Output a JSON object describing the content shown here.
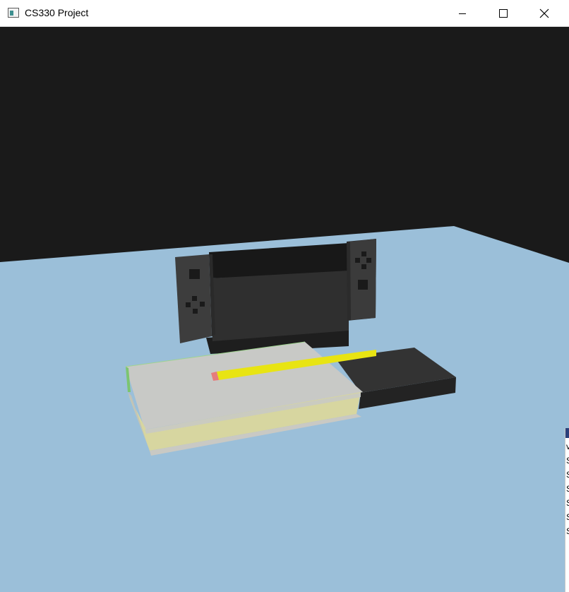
{
  "window": {
    "title": "CS330 Project"
  },
  "titlebar_icons": {
    "app": "app-window-icon",
    "minimize": "minimize-icon",
    "maximize": "maximize-icon",
    "close": "close-icon"
  },
  "scene": {
    "background_color": "#1a1a1a",
    "table_color": "#9bbfd9",
    "objects": [
      "game-console-with-controllers",
      "dock",
      "book",
      "pencil",
      "black-case"
    ]
  },
  "side_strip": {
    "chars": [
      "v",
      "S",
      "S",
      "S",
      "S",
      "S",
      "S"
    ]
  }
}
